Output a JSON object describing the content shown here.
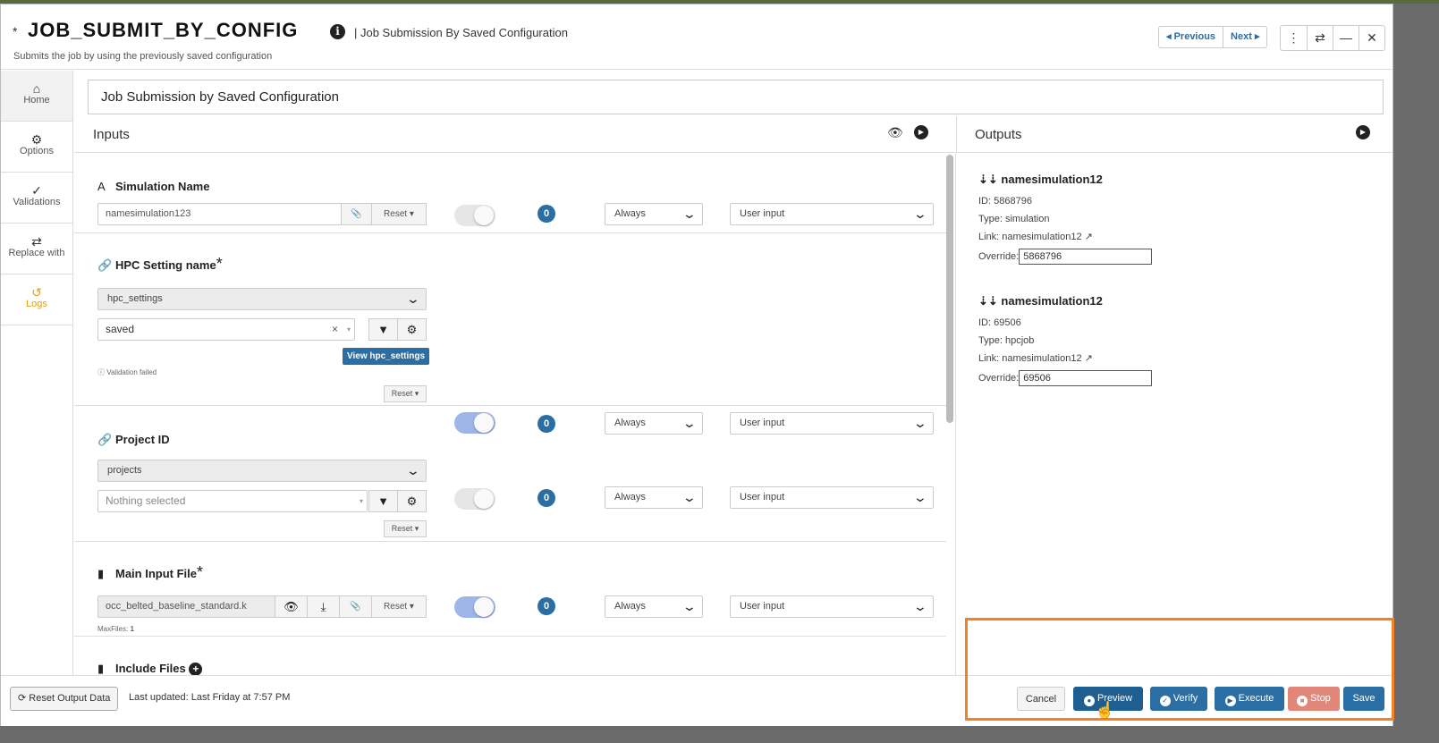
{
  "header": {
    "star": "*",
    "title": "JOB_SUBMIT_BY_CONFIG",
    "info_icon": "info-icon",
    "subtitle": "| Job Submission By Saved Configuration",
    "description": "Submits the job by using the previously saved configuration",
    "previous_label": "◂ Previous",
    "next_label": "Next ▸",
    "window_buttons": [
      "⋮",
      "⇄",
      "—",
      "✕"
    ]
  },
  "sidebar": {
    "items": [
      {
        "label": "Home",
        "icon": "home-icon"
      },
      {
        "label": "Options",
        "icon": "gear-icon"
      },
      {
        "label": "Validations",
        "icon": "check-icon"
      },
      {
        "label": "Replace with",
        "icon": "swap-icon"
      },
      {
        "label": "Logs",
        "icon": "history-icon"
      }
    ]
  },
  "job_title": "Job Submission by Saved Configuration",
  "inputs": {
    "heading": "Inputs",
    "fields": [
      {
        "label": "Simulation Name",
        "value": "namesimulation123",
        "reset": "Reset",
        "badge": "0",
        "toggle_on": false,
        "frequency": "Always",
        "source": "User input"
      },
      {
        "label": "HPC Setting name",
        "required": "*",
        "select": "hpc_settings",
        "value": "saved",
        "view_button": "View hpc_settings",
        "validation": "Validation failed",
        "reset": "Reset",
        "badge": "0",
        "toggle_on": true,
        "frequency": "Always",
        "source": "User input"
      },
      {
        "label": "Project ID",
        "select": "projects",
        "placeholder": "Nothing selected",
        "reset": "Reset",
        "badge": "0",
        "toggle_on": false,
        "frequency": "Always",
        "source": "User input"
      },
      {
        "label": "Main Input File",
        "required": "*",
        "value": "occ_belted_baseline_standard.k",
        "reset": "Reset",
        "maxfiles_label": "MaxFiles:",
        "maxfiles_value": "1",
        "badge": "0",
        "toggle_on": true,
        "frequency": "Always",
        "source": "User input"
      },
      {
        "label": "Include Files"
      }
    ]
  },
  "outputs": {
    "heading": "Outputs",
    "items": [
      {
        "name": "namesimulation12",
        "id": "ID: 5868796",
        "type": "Type: simulation",
        "link": "Link: namesimulation12",
        "override_label": "Override:",
        "override_value": "5868796"
      },
      {
        "name": "namesimulation12",
        "id": "ID: 69506",
        "type": "Type: hpcjob",
        "link": "Link: namesimulation12",
        "override_label": "Override:",
        "override_value": "69506"
      }
    ]
  },
  "footer": {
    "reset_output": "Reset Output Data",
    "last_updated": "Last updated: Last Friday at 7:57 PM",
    "cancel": "Cancel",
    "preview": "Preview",
    "verify": "Verify",
    "execute": "Execute",
    "stop": "Stop",
    "save": "Save"
  },
  "colors": {
    "primary": "#2a6ea3",
    "stop": "#e0877a",
    "highlight": "#f58220",
    "logs": "#e0a020"
  }
}
